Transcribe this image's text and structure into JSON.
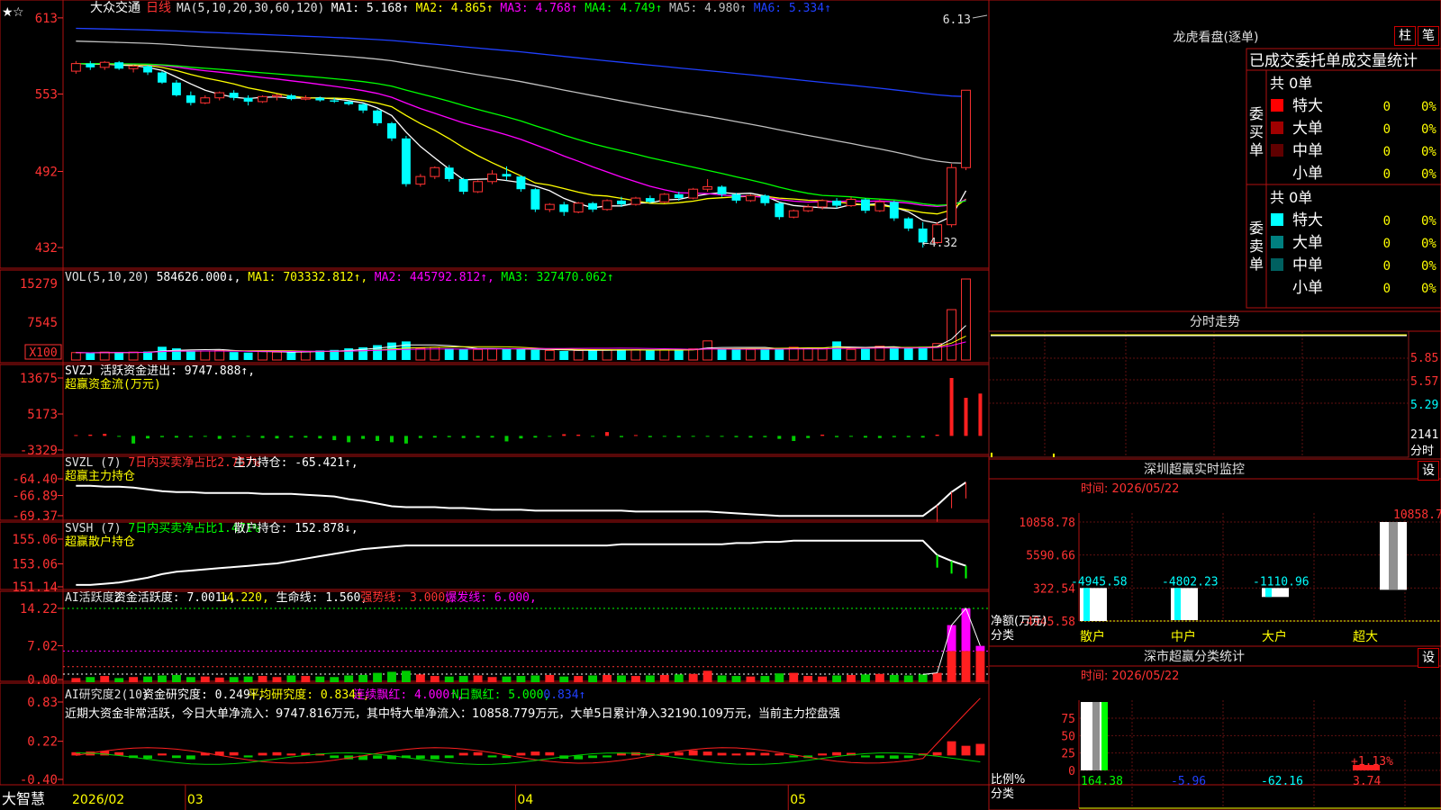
{
  "stock": {
    "name": "大众交通",
    "period": "日线"
  },
  "colors": {
    "up": "#ff3232",
    "down": "#00ffff",
    "panel_border": "#b01010",
    "ma": [
      "#ffffff",
      "#ffff00",
      "#ff00ff",
      "#00ff00",
      "#c0c0c0",
      "#2040ff"
    ]
  },
  "main_header": [
    {
      "t": "MA(5,10,20,30,60,120)",
      "c": "#e0e0e0"
    },
    {
      "t": "MA1: 5.168↑",
      "c": "#ffffff"
    },
    {
      "t": "MA2: 4.865↑",
      "c": "#ffff00"
    },
    {
      "t": "MA3: 4.768↑",
      "c": "#ff00ff"
    },
    {
      "t": "MA4: 4.749↑",
      "c": "#00ff00"
    },
    {
      "t": "MA5: 4.980↑",
      "c": "#c0c0c0"
    },
    {
      "t": "MA6: 5.334↑",
      "c": "#2040ff"
    }
  ],
  "vol_header": [
    {
      "t": "VOL(5,10,20)",
      "c": "#e0e0e0"
    },
    {
      "t": "584626.000↓,",
      "c": "#ffffff"
    },
    {
      "t": "MA1: 703332.812↑,",
      "c": "#ffff00"
    },
    {
      "t": "MA2: 445792.812↑,",
      "c": "#ff00ff"
    },
    {
      "t": "MA3: 327470.062↑",
      "c": "#00ff00"
    }
  ],
  "svzj_header": [
    {
      "t": "SVZJ  活跃资金进出: 9747.888↑,",
      "c": "#ffffff"
    },
    {
      "t": "超赢资金流(万元)",
      "c": "#ffff00",
      "row": 2
    }
  ],
  "svzl_header": [
    {
      "t": "SVZL (7)",
      "c": "#e0e0e0"
    },
    {
      "t": "7日内买卖净占比2.757%",
      "c": "#ff3232"
    },
    {
      "t": "主力持仓: -65.421↑,",
      "c": "#ffffff"
    },
    {
      "t": "超赢主力持仓",
      "c": "#ffff00",
      "row": 2
    }
  ],
  "svsh_header": [
    {
      "t": "SVSH (7)",
      "c": "#e0e0e0"
    },
    {
      "t": "7日内买卖净占比1.471%",
      "c": "#00ff00"
    },
    {
      "t": "散户持仓: 152.878↓,",
      "c": "#ffffff"
    },
    {
      "t": "超赢散户持仓",
      "c": "#ffff00",
      "row": 2
    }
  ],
  "ai_header": [
    {
      "t": "AI活跃度2",
      "c": "#e0e0e0"
    },
    {
      "t": "资金活跃度: 7.001↓,",
      "c": "#ffffff"
    },
    {
      "t": "14.220,",
      "c": "#ffff00"
    },
    {
      "t": "生命线: 1.560,",
      "c": "#ffffff"
    },
    {
      "t": "强势线: 3.000,",
      "c": "#ff3232"
    },
    {
      "t": "爆发线: 6.000,",
      "c": "#ff00ff"
    }
  ],
  "ai2_header": [
    {
      "t": "AI研究度2(10)",
      "c": "#e0e0e0"
    },
    {
      "t": "资金研究度: 0.249↑,",
      "c": "#ffffff"
    },
    {
      "t": "平均研究度: 0.834↑,",
      "c": "#ffff00"
    },
    {
      "t": "连续飘红: 4.000↑,",
      "c": "#ff00ff"
    },
    {
      "t": "N日飘红: 5.000,",
      "c": "#00ff00"
    },
    {
      "t": "0.834↑",
      "c": "#2040ff"
    }
  ],
  "ai2_comment": "近期大资金非常活跃，今日大单净流入：9747.816万元，其中特大单净流入：10858.779万元，大单5日累计净入32190.109万元，当前主力控盘强",
  "axes": {
    "price_ticks": [
      "613",
      "553",
      "492",
      "432"
    ],
    "vol_ticks": [
      "15279",
      "7545",
      "X100"
    ],
    "svzj_ticks": [
      "13675",
      "5173",
      "-3329"
    ],
    "svzl_ticks": [
      "-64.40",
      "-66.89",
      "-69.37"
    ],
    "svsh_ticks": [
      "155.06",
      "153.06",
      "151.14"
    ],
    "ai_ticks": [
      "14.22",
      "7.02",
      "0.00"
    ],
    "ai2_ticks": [
      "0.83",
      "0.22",
      "-0.40"
    ]
  },
  "date_axis": {
    "left": "2026/02",
    "labels": [
      "03",
      "04",
      "05"
    ]
  },
  "brand": "大智慧",
  "price_annotations": {
    "high": "6.13",
    "low": "←4.32"
  },
  "dragon": {
    "title": "龙虎看盘(逐单)",
    "tabs": [
      "柱",
      "笔"
    ],
    "subtitle": "已成交委托单成交量统计",
    "buy": {
      "label": "委买单",
      "total": "共 0单",
      "rows": [
        {
          "name": "特大",
          "val": "0",
          "pct": "0%",
          "color": "#ff0000"
        },
        {
          "name": "大单",
          "val": "0",
          "pct": "0%",
          "color": "#a00000"
        },
        {
          "name": "中单",
          "val": "0",
          "pct": "0%",
          "color": "#600000"
        },
        {
          "name": "小单",
          "val": "0",
          "pct": "0%",
          "color": ""
        }
      ]
    },
    "sell": {
      "label": "委卖单",
      "total": "共 0单",
      "rows": [
        {
          "name": "特大",
          "val": "0",
          "pct": "0%",
          "color": "#00ffff"
        },
        {
          "name": "大单",
          "val": "0",
          "pct": "0%",
          "color": "#008080"
        },
        {
          "name": "中单",
          "val": "0",
          "pct": "0%",
          "color": "#006060"
        },
        {
          "name": "小单",
          "val": "0",
          "pct": "0%",
          "color": ""
        }
      ]
    }
  },
  "intraday": {
    "title": "分时走势",
    "ticks": [
      "5.85",
      "5.57",
      "5.29",
      "2141",
      "分时"
    ]
  },
  "monitor": {
    "title": "深圳超赢实时监控",
    "button": "设",
    "time": "时间: 2026/05/22",
    "y_ticks": [
      "10858.78",
      "5590.66",
      "322.54",
      "-4945.58"
    ],
    "y_label": "净额(万元)",
    "x_label": "分类"
  },
  "classify": {
    "title": "深市超赢分类统计",
    "button": "设",
    "time": "时间: 2026/05/22",
    "y_ticks": [
      "75",
      "50",
      "25",
      "0"
    ],
    "y_label": "比例%",
    "x_label": "分类"
  },
  "chart_data": [
    {
      "type": "candlestick",
      "title": "大众交通 日线",
      "ylim": [
        4.2,
        6.2
      ],
      "ohlc": [
        [
          5.71,
          5.79,
          5.69,
          5.77
        ],
        [
          5.77,
          5.79,
          5.72,
          5.74
        ],
        [
          5.74,
          5.79,
          5.72,
          5.78
        ],
        [
          5.78,
          5.79,
          5.72,
          5.73
        ],
        [
          5.73,
          5.76,
          5.7,
          5.75
        ],
        [
          5.75,
          5.76,
          5.68,
          5.7
        ],
        [
          5.7,
          5.71,
          5.61,
          5.62
        ],
        [
          5.62,
          5.64,
          5.51,
          5.52
        ],
        [
          5.52,
          5.55,
          5.44,
          5.46
        ],
        [
          5.46,
          5.52,
          5.45,
          5.5
        ],
        [
          5.5,
          5.55,
          5.48,
          5.54
        ],
        [
          5.54,
          5.56,
          5.48,
          5.5
        ],
        [
          5.5,
          5.52,
          5.44,
          5.47
        ],
        [
          5.47,
          5.52,
          5.46,
          5.51
        ],
        [
          5.51,
          5.53,
          5.48,
          5.52
        ],
        [
          5.52,
          5.53,
          5.48,
          5.49
        ],
        [
          5.49,
          5.52,
          5.48,
          5.5
        ],
        [
          5.5,
          5.51,
          5.47,
          5.48
        ],
        [
          5.48,
          5.5,
          5.46,
          5.47
        ],
        [
          5.47,
          5.48,
          5.44,
          5.45
        ],
        [
          5.45,
          5.46,
          5.38,
          5.4
        ],
        [
          5.4,
          5.41,
          5.28,
          5.3
        ],
        [
          5.3,
          5.31,
          5.16,
          5.18
        ],
        [
          5.18,
          5.2,
          4.8,
          4.82
        ],
        [
          4.82,
          4.9,
          4.8,
          4.88
        ],
        [
          4.88,
          4.96,
          4.86,
          4.95
        ],
        [
          4.95,
          4.97,
          4.84,
          4.86
        ],
        [
          4.86,
          4.87,
          4.74,
          4.76
        ],
        [
          4.76,
          4.85,
          4.75,
          4.84
        ],
        [
          4.84,
          4.93,
          4.82,
          4.9
        ],
        [
          4.9,
          4.96,
          4.85,
          4.88
        ],
        [
          4.88,
          4.89,
          4.76,
          4.78
        ],
        [
          4.78,
          4.79,
          4.6,
          4.62
        ],
        [
          4.62,
          4.67,
          4.6,
          4.66
        ],
        [
          4.66,
          4.68,
          4.57,
          4.6
        ],
        [
          4.6,
          4.68,
          4.59,
          4.67
        ],
        [
          4.67,
          4.68,
          4.6,
          4.62
        ],
        [
          4.62,
          4.7,
          4.61,
          4.69
        ],
        [
          4.69,
          4.72,
          4.64,
          4.66
        ],
        [
          4.66,
          4.72,
          4.65,
          4.71
        ],
        [
          4.71,
          4.73,
          4.67,
          4.68
        ],
        [
          4.68,
          4.75,
          4.67,
          4.74
        ],
        [
          4.74,
          4.76,
          4.69,
          4.71
        ],
        [
          4.71,
          4.79,
          4.7,
          4.78
        ],
        [
          4.78,
          4.86,
          4.76,
          4.8
        ],
        [
          4.8,
          4.81,
          4.72,
          4.74
        ],
        [
          4.74,
          4.75,
          4.67,
          4.69
        ],
        [
          4.69,
          4.74,
          4.68,
          4.73
        ],
        [
          4.73,
          4.74,
          4.65,
          4.67
        ],
        [
          4.67,
          4.68,
          4.54,
          4.56
        ],
        [
          4.56,
          4.62,
          4.55,
          4.61
        ],
        [
          4.61,
          4.66,
          4.6,
          4.64
        ],
        [
          4.64,
          4.7,
          4.62,
          4.69
        ],
        [
          4.69,
          4.71,
          4.63,
          4.65
        ],
        [
          4.65,
          4.72,
          4.64,
          4.7
        ],
        [
          4.7,
          4.71,
          4.59,
          4.61
        ],
        [
          4.61,
          4.7,
          4.6,
          4.68
        ],
        [
          4.68,
          4.69,
          4.53,
          4.55
        ],
        [
          4.55,
          4.56,
          4.45,
          4.47
        ],
        [
          4.47,
          4.52,
          4.32,
          4.36
        ],
        [
          4.36,
          4.52,
          4.35,
          4.5
        ],
        [
          4.5,
          4.98,
          4.48,
          4.95
        ],
        [
          4.95,
          5.56,
          4.93,
          5.56
        ]
      ]
    },
    {
      "type": "bar",
      "title": "VOL(5,10,20)",
      "ylabel": "X100",
      "ylim": [
        0,
        15279
      ],
      "values": [
        1400,
        1300,
        1500,
        1400,
        1500,
        1600,
        2500,
        2200,
        1800,
        1700,
        1800,
        1500,
        1400,
        1600,
        1500,
        1500,
        1600,
        1800,
        1900,
        2200,
        2400,
        2800,
        3300,
        3500,
        2200,
        2400,
        2200,
        2100,
        2000,
        2100,
        2200,
        2000,
        1900,
        1800,
        1700,
        1800,
        1900,
        1900,
        2000,
        1900,
        1800,
        1900,
        2000,
        2100,
        3600,
        2200,
        2000,
        2000,
        2100,
        2300,
        2400,
        2200,
        2100,
        3500,
        2000,
        2100,
        2600,
        2300,
        2200,
        2500,
        3100,
        9500,
        15279
      ]
    },
    {
      "type": "bar",
      "title": "SVZJ 活跃资金进出",
      "ylim": [
        -3329,
        13675
      ],
      "values": [
        200,
        300,
        500,
        -200,
        -1800,
        -600,
        -300,
        -400,
        -300,
        -200,
        -700,
        -300,
        -200,
        -500,
        -600,
        -400,
        -400,
        -600,
        -1000,
        -1500,
        -700,
        -1200,
        -1500,
        -1800,
        -500,
        -400,
        -300,
        -500,
        -400,
        -400,
        -1300,
        -600,
        -400,
        -200,
        400,
        300,
        -200,
        900,
        -300,
        200,
        -300,
        -200,
        -300,
        -200,
        -200,
        -200,
        -300,
        -400,
        -300,
        -700,
        -1200,
        -500,
        300,
        -300,
        -200,
        -400,
        -500,
        -300,
        -300,
        -400,
        300,
        13675,
        9000,
        10000
      ]
    },
    {
      "type": "line",
      "title": "SVZL 主力持仓",
      "ylim": [
        -69.37,
        -64.4
      ],
      "values": [
        -65.8,
        -65.8,
        -65.9,
        -65.9,
        -66.0,
        -66.2,
        -66.4,
        -66.5,
        -66.5,
        -66.6,
        -66.6,
        -66.6,
        -66.6,
        -66.7,
        -66.7,
        -66.7,
        -66.8,
        -66.9,
        -67.0,
        -67.3,
        -67.5,
        -67.8,
        -68.1,
        -68.2,
        -68.2,
        -68.2,
        -68.3,
        -68.3,
        -68.4,
        -68.5,
        -68.5,
        -68.5,
        -68.6,
        -68.6,
        -68.6,
        -68.6,
        -68.6,
        -68.6,
        -68.6,
        -68.7,
        -68.7,
        -68.7,
        -68.7,
        -68.7,
        -68.7,
        -68.8,
        -68.9,
        -69.0,
        -69.1,
        -69.2,
        -69.2,
        -69.2,
        -69.2,
        -69.2,
        -69.2,
        -69.2,
        -69.2,
        -69.2,
        -69.2,
        -69.2,
        -68.0,
        -66.5,
        -65.4
      ]
    },
    {
      "type": "line",
      "title": "SVSH 散户持仓",
      "ylim": [
        151.14,
        155.06
      ],
      "values": [
        151.3,
        151.3,
        151.4,
        151.5,
        151.7,
        151.9,
        152.2,
        152.4,
        152.5,
        152.6,
        152.7,
        152.8,
        152.9,
        153.0,
        153.1,
        153.3,
        153.5,
        153.7,
        153.9,
        154.1,
        154.3,
        154.4,
        154.5,
        154.6,
        154.6,
        154.6,
        154.6,
        154.6,
        154.6,
        154.6,
        154.6,
        154.6,
        154.6,
        154.6,
        154.6,
        154.6,
        154.6,
        154.6,
        154.7,
        154.7,
        154.7,
        154.7,
        154.7,
        154.7,
        154.7,
        154.7,
        154.8,
        154.8,
        154.9,
        154.9,
        155.0,
        155.0,
        155.0,
        155.0,
        155.0,
        155.0,
        155.0,
        155.0,
        155.0,
        155.0,
        153.8,
        153.3,
        152.9
      ]
    },
    {
      "type": "bar",
      "title": "AI活跃度2",
      "ylim": [
        0,
        14.22
      ],
      "values": [
        0.8,
        1.0,
        1.2,
        0.8,
        1.0,
        1.1,
        1.3,
        1.4,
        1.0,
        1.1,
        0.9,
        1.0,
        1.1,
        1.2,
        1.0,
        1.3,
        1.2,
        1.1,
        1.0,
        1.3,
        1.4,
        1.8,
        2.0,
        2.2,
        1.5,
        1.2,
        1.1,
        1.2,
        1.3,
        1.0,
        1.1,
        1.2,
        1.3,
        1.4,
        1.1,
        1.2,
        1.3,
        1.4,
        1.3,
        1.2,
        1.3,
        1.4,
        1.5,
        1.6,
        2.2,
        1.3,
        1.2,
        1.1,
        1.2,
        1.7,
        1.8,
        1.2,
        1.1,
        1.3,
        1.4,
        1.5,
        1.6,
        1.4,
        1.3,
        1.5,
        1.8,
        11.0,
        14.22,
        7.0
      ]
    },
    {
      "type": "bar",
      "title": "AI研究度2(10)",
      "ylim": [
        -0.4,
        0.83
      ],
      "values": [
        0.05,
        0.06,
        0.07,
        0.05,
        -0.04,
        -0.05,
        0.03,
        -0.04,
        -0.06,
        0.04,
        0.06,
        0.05,
        -0.03,
        0.04,
        0.05,
        0.03,
        0.04,
        0.03,
        -0.04,
        -0.06,
        -0.07,
        -0.05,
        -0.06,
        -0.04,
        -0.05,
        -0.06,
        -0.04,
        0.04,
        0.05,
        -0.03,
        -0.04,
        0.04,
        0.06,
        0.05,
        -0.05,
        -0.06,
        -0.04,
        -0.03,
        0.04,
        0.05,
        0.03,
        0.04,
        0.05,
        0.08,
        0.06,
        0.04,
        0.03,
        0.05,
        0.04,
        0.03,
        -0.03,
        -0.04,
        0.03,
        0.05,
        0.04,
        -0.03,
        -0.04,
        -0.05,
        -0.04,
        0.03,
        0.05,
        0.22,
        0.15,
        0.18
      ]
    },
    {
      "type": "bar",
      "title": "深圳超赢实时监控",
      "ylabel": "净额(万元)",
      "categories": [
        "散户",
        "中户",
        "大户",
        "超大"
      ],
      "values": [
        -4945.58,
        -4802.23,
        -1110.96,
        10858.78
      ],
      "ylim": [
        -4945.58,
        10858.78
      ]
    },
    {
      "type": "bar",
      "title": "深市超赢分类统计",
      "ylabel": "比例%",
      "categories": [
        "散户",
        "中户",
        "大户",
        "超大"
      ],
      "values": [
        164.38,
        -5.96,
        -62.16,
        3.74
      ],
      "ylim": [
        0,
        75
      ],
      "annotations": [
        "+1.13%"
      ]
    }
  ]
}
